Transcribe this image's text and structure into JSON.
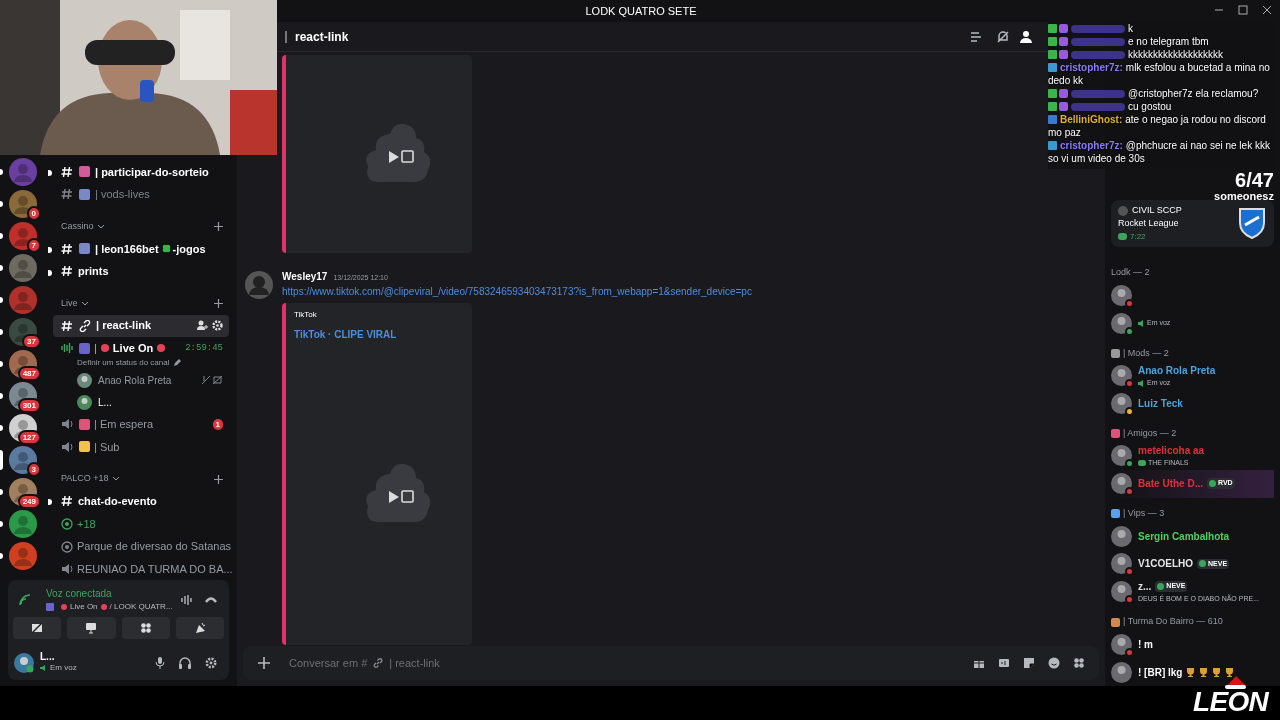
{
  "window": {
    "title": "LODK QUATRO SETE"
  },
  "servers": [
    {
      "selected": false
    },
    {
      "selected": false,
      "badge": "0"
    },
    {
      "selected": false,
      "badge": "7"
    },
    {
      "selected": false
    },
    {
      "selected": false
    },
    {
      "selected": false,
      "badge": "37"
    },
    {
      "selected": false,
      "badge": "487"
    },
    {
      "selected": false,
      "badge": "301"
    },
    {
      "selected": false,
      "badge": "127"
    },
    {
      "selected": true,
      "badge": "3"
    },
    {
      "selected": false,
      "badge": "249"
    },
    {
      "selected": false
    },
    {
      "selected": false
    }
  ],
  "channels": [
    {
      "kind": "text",
      "name": "| participar-do-sorteio",
      "unread": true,
      "selected": false
    },
    {
      "kind": "text",
      "name": "| vods-lives",
      "unread": false,
      "selected": false
    },
    {
      "kind": "category",
      "name": "Cassino"
    },
    {
      "kind": "text",
      "name": "| leon166bet",
      "suffix": "-jogos",
      "unread": true,
      "selected": false
    },
    {
      "kind": "text",
      "name": "prints",
      "unread": true,
      "selected": false
    },
    {
      "kind": "category",
      "name": "Live"
    },
    {
      "kind": "text",
      "name": "| react-link",
      "unread": true,
      "selected": true
    },
    {
      "kind": "voice",
      "name": "Live On",
      "separator": "|",
      "active": true,
      "timer": "2:59:45",
      "status": "Definir um status do canal",
      "users": [
        {
          "name": "Anao Rola Preta",
          "muted": true
        },
        {
          "name": "L...",
          "muted": false
        }
      ]
    },
    {
      "kind": "voice",
      "name": "| Em espera",
      "active": false,
      "badge": "1"
    },
    {
      "kind": "voice",
      "name": "| Sub",
      "active": false
    },
    {
      "kind": "category",
      "name": "PALCO +18"
    },
    {
      "kind": "text",
      "name": "chat-do-evento",
      "unread": true,
      "selected": false
    },
    {
      "kind": "stage",
      "name": "+18",
      "active": true
    },
    {
      "kind": "stage",
      "name": "Parque de diversao do Satanas",
      "active": false
    },
    {
      "kind": "voice",
      "name": "REUNIAO DA TURMA DO BA...",
      "active": false
    }
  ],
  "voice_panel": {
    "title": "Voz conectada",
    "channel": "Live On",
    "server": "/ LOOK QUATR...",
    "user": "L...",
    "user_status": "Em voz"
  },
  "header": {
    "channel": "react-link"
  },
  "messages": [
    {
      "kind": "embed_only"
    },
    {
      "kind": "message",
      "author": "Wesley17",
      "time": "13/12/2025 12:10",
      "link": "https://www.tiktok.com/@clipeviral_/video/7583246593403473173?is_from_webapp=1&sender_device=pc",
      "embed": {
        "provider": "TikTok",
        "title": "TikTok · CLIPE VIRAL"
      }
    }
  ],
  "message_input": {
    "prefix": "Conversar em #",
    "channel": "| react-link"
  },
  "activity": {
    "count": "6/47",
    "user": "someonesz",
    "card": {
      "user": "CIVIL SCCP",
      "game": "Rocket League",
      "time": "7:22"
    }
  },
  "member_groups": [
    {
      "title": "Lodk — 2",
      "members": [
        {
          "status": {
            "color": "#da373c"
          }
        },
        {
          "status": {
            "color": "#3ba55c"
          },
          "activity": "Em voz"
        }
      ]
    },
    {
      "title": "| Mods — 2",
      "members": [
        {
          "name": "Anao Rola Preta",
          "color": "#4aa3df",
          "status": {
            "color": "#da373c"
          },
          "activity": "Em voz"
        },
        {
          "name": "Luiz Teck",
          "color": "#4aa3df",
          "status": {
            "color": "#f0b232"
          }
        }
      ]
    },
    {
      "title": "| Amigos — 2",
      "members": [
        {
          "name": "metelicoha aa",
          "color": "#e0303a",
          "status": {
            "color": "#3ba55c"
          },
          "activity": "THE FINALS"
        },
        {
          "name": "Bate Uthe D...",
          "color": "#e0303a",
          "status": {
            "color": "#da373c"
          },
          "tag": "RVD"
        }
      ]
    },
    {
      "title": "| Vips — 3",
      "members": [
        {
          "name": "Sergin Cambalhota",
          "color": "#4ad35a"
        },
        {
          "name": "V1COELHO",
          "color": "#e6e6e6",
          "status": {
            "color": "#da373c"
          },
          "tag": "NEVE"
        },
        {
          "name": "z...",
          "color": "#e6e6e6",
          "status": {
            "color": "#da373c"
          },
          "tag": "NEVE",
          "activity": "DEUS É BOM E O DIABO NÃO PRE..."
        }
      ]
    },
    {
      "title": "| Turma Do Bairro — 610",
      "members": [
        {
          "name": "! m",
          "color": "#ffffff",
          "status": {
            "color": "#da373c"
          }
        },
        {
          "name": "! [BR] lkg",
          "color": "#ffffff",
          "badges": [
            {
              "kind": "trophy"
            },
            {
              "kind": "trophy"
            },
            {
              "kind": "trophy"
            },
            {
              "kind": "trophy"
            }
          ]
        }
      ]
    }
  ],
  "stream_chat": [
    {
      "user_hidden": true,
      "text": "k"
    },
    {
      "user_hidden": true,
      "text": "e no telegram tbm"
    },
    {
      "user_hidden": true,
      "text": "kkkkkkkkkkkkkkkkkkk"
    },
    {
      "user_hidden": false,
      "user": "cristopher7z:",
      "color": "#8b7bff",
      "text": "mlk esfolou a bucetad a mina no dedo kk"
    },
    {
      "user_hidden": true,
      "text": "@cristopher7z ela reclamou?"
    },
    {
      "user_hidden": true,
      "text": "cu gostou"
    },
    {
      "user_hidden": false,
      "user": "BelliniGhost:",
      "color": "#e0b030",
      "text": "ate o negao ja rodou no discord mo paz"
    },
    {
      "user_hidden": false,
      "user": "cristopher7z:",
      "color": "#8b7bff",
      "text": "@phchucre ai nao sei ne lek kkk so vi um video de 30s"
    }
  ],
  "stream_logo": "LEON"
}
